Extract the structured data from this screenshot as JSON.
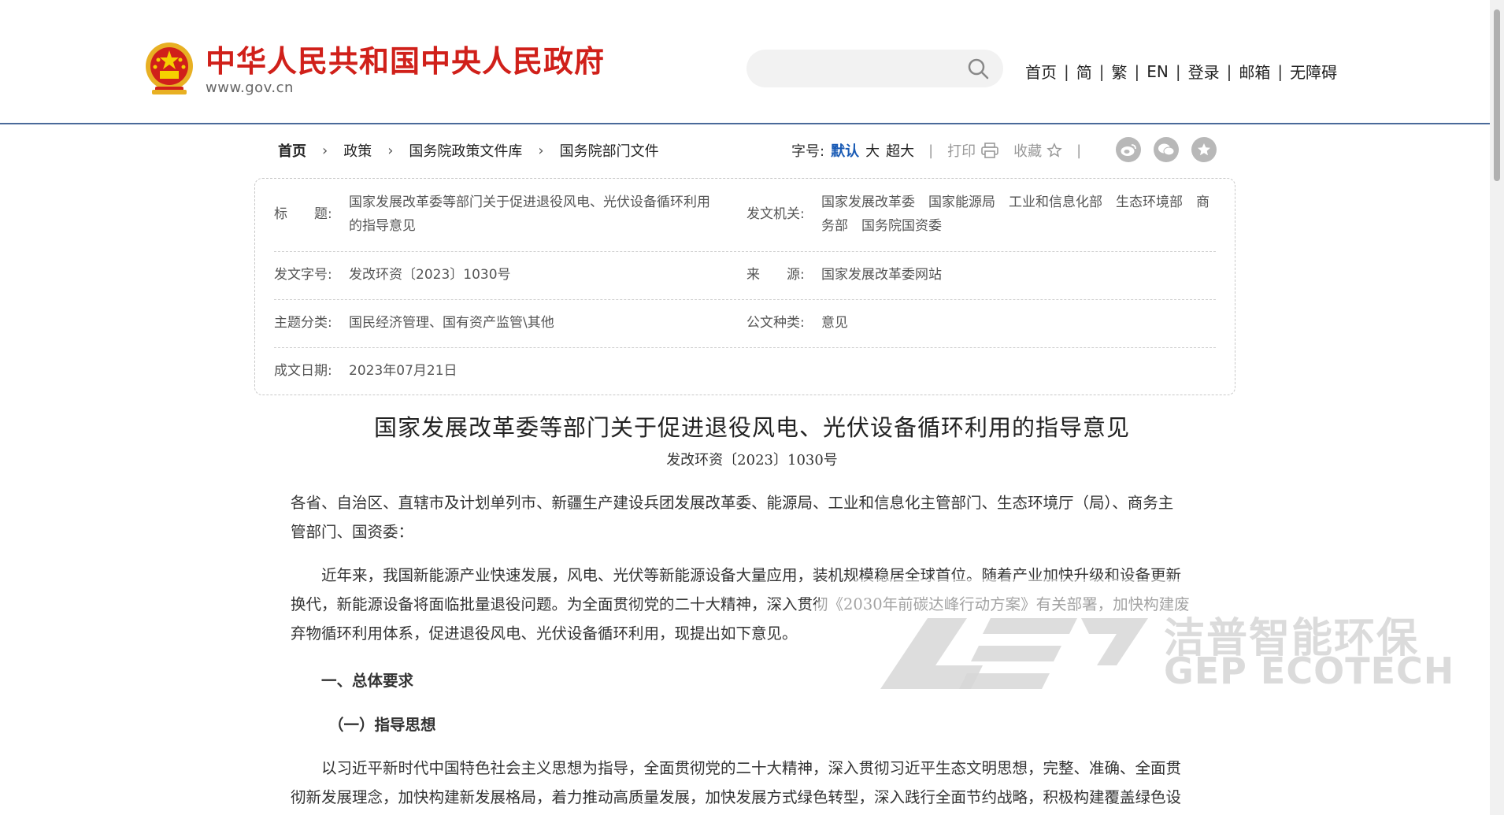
{
  "header": {
    "site_name": "中华人民共和国中央人民政府",
    "site_url": "www.gov.cn",
    "search_placeholder": "",
    "nav": [
      "首页",
      "简",
      "繁",
      "EN",
      "登录",
      "邮箱",
      "无障碍"
    ]
  },
  "breadcrumb": [
    "首页",
    "政策",
    "国务院政策文件库",
    "国务院部门文件"
  ],
  "tools": {
    "font_label": "字号:",
    "sizes": [
      "默认",
      "大",
      "超大"
    ],
    "print": "打印",
    "favorite": "收藏"
  },
  "share_icons": [
    "weibo-icon",
    "wechat-icon",
    "star-icon"
  ],
  "meta": {
    "title_key": "标　　题:",
    "title_val_1": "国家发展改革委等部门关于促进退役风电、光伏设备循环利用",
    "title_val_2": "的指导意见",
    "issuer_key": "发文机关:",
    "issuer_val_1": "国家发展改革委　国家能源局　工业和信息化部　生态环境部　商",
    "issuer_val_2": "务部　国务院国资委",
    "docno_key": "发文字号:",
    "docno_val": "发改环资〔2023〕1030号",
    "source_key": "来　　源:",
    "source_val": "国家发展改革委网站",
    "topic_key": "主题分类:",
    "topic_val": "国民经济管理、国有资产监管\\其他",
    "type_key": "公文种类:",
    "type_val": "意见",
    "date_key": "成文日期:",
    "date_val": "2023年07月21日"
  },
  "document": {
    "title": "国家发展改革委等部门关于促进退役风电、光伏设备循环利用的指导意见",
    "doc_no": "发改环资〔2023〕1030号",
    "addressee_1": "各省、自治区、直辖市及计划单列市、新疆生产建设兵团发展改革委、能源局、工业和信息化主管部门、生态环境厅（局）、商务主",
    "addressee_2": "管部门、国资委：",
    "p1_1": "近年来，我国新能源产业快速发展，风电、光伏等新能源设备大量应用，装机规模稳居全球首位。随着产业加快升级和设备更新",
    "p1_2": "换代，新能源设备将面临批量退役问题。为全面贯彻党的二十大精神，深入贯彻《2030年前碳达峰行动方案》有关部署，加快构建废",
    "p1_3": "弃物循环利用体系，促进退役风电、光伏设备循环利用，现提出如下意见。",
    "h1": "一、总体要求",
    "h2": "（一）指导思想",
    "p2_1": "以习近平新时代中国特色社会主义思想为指导，全面贯彻党的二十大精神，深入贯彻习近平生态文明思想，完整、准确、全面贯",
    "p2_2": "彻新发展理念，加快构建新发展格局，着力推动高质量发展，加快发展方式绿色转型，深入践行全面节约战略，积极构建覆盖绿色设"
  },
  "watermark": {
    "cn": "洁普智能环保",
    "en": "GEP ECOTECH"
  },
  "colors": {
    "brand_red": "#d0201a",
    "link_blue": "#1a5bb5",
    "header_border": "#4a6a9a"
  }
}
